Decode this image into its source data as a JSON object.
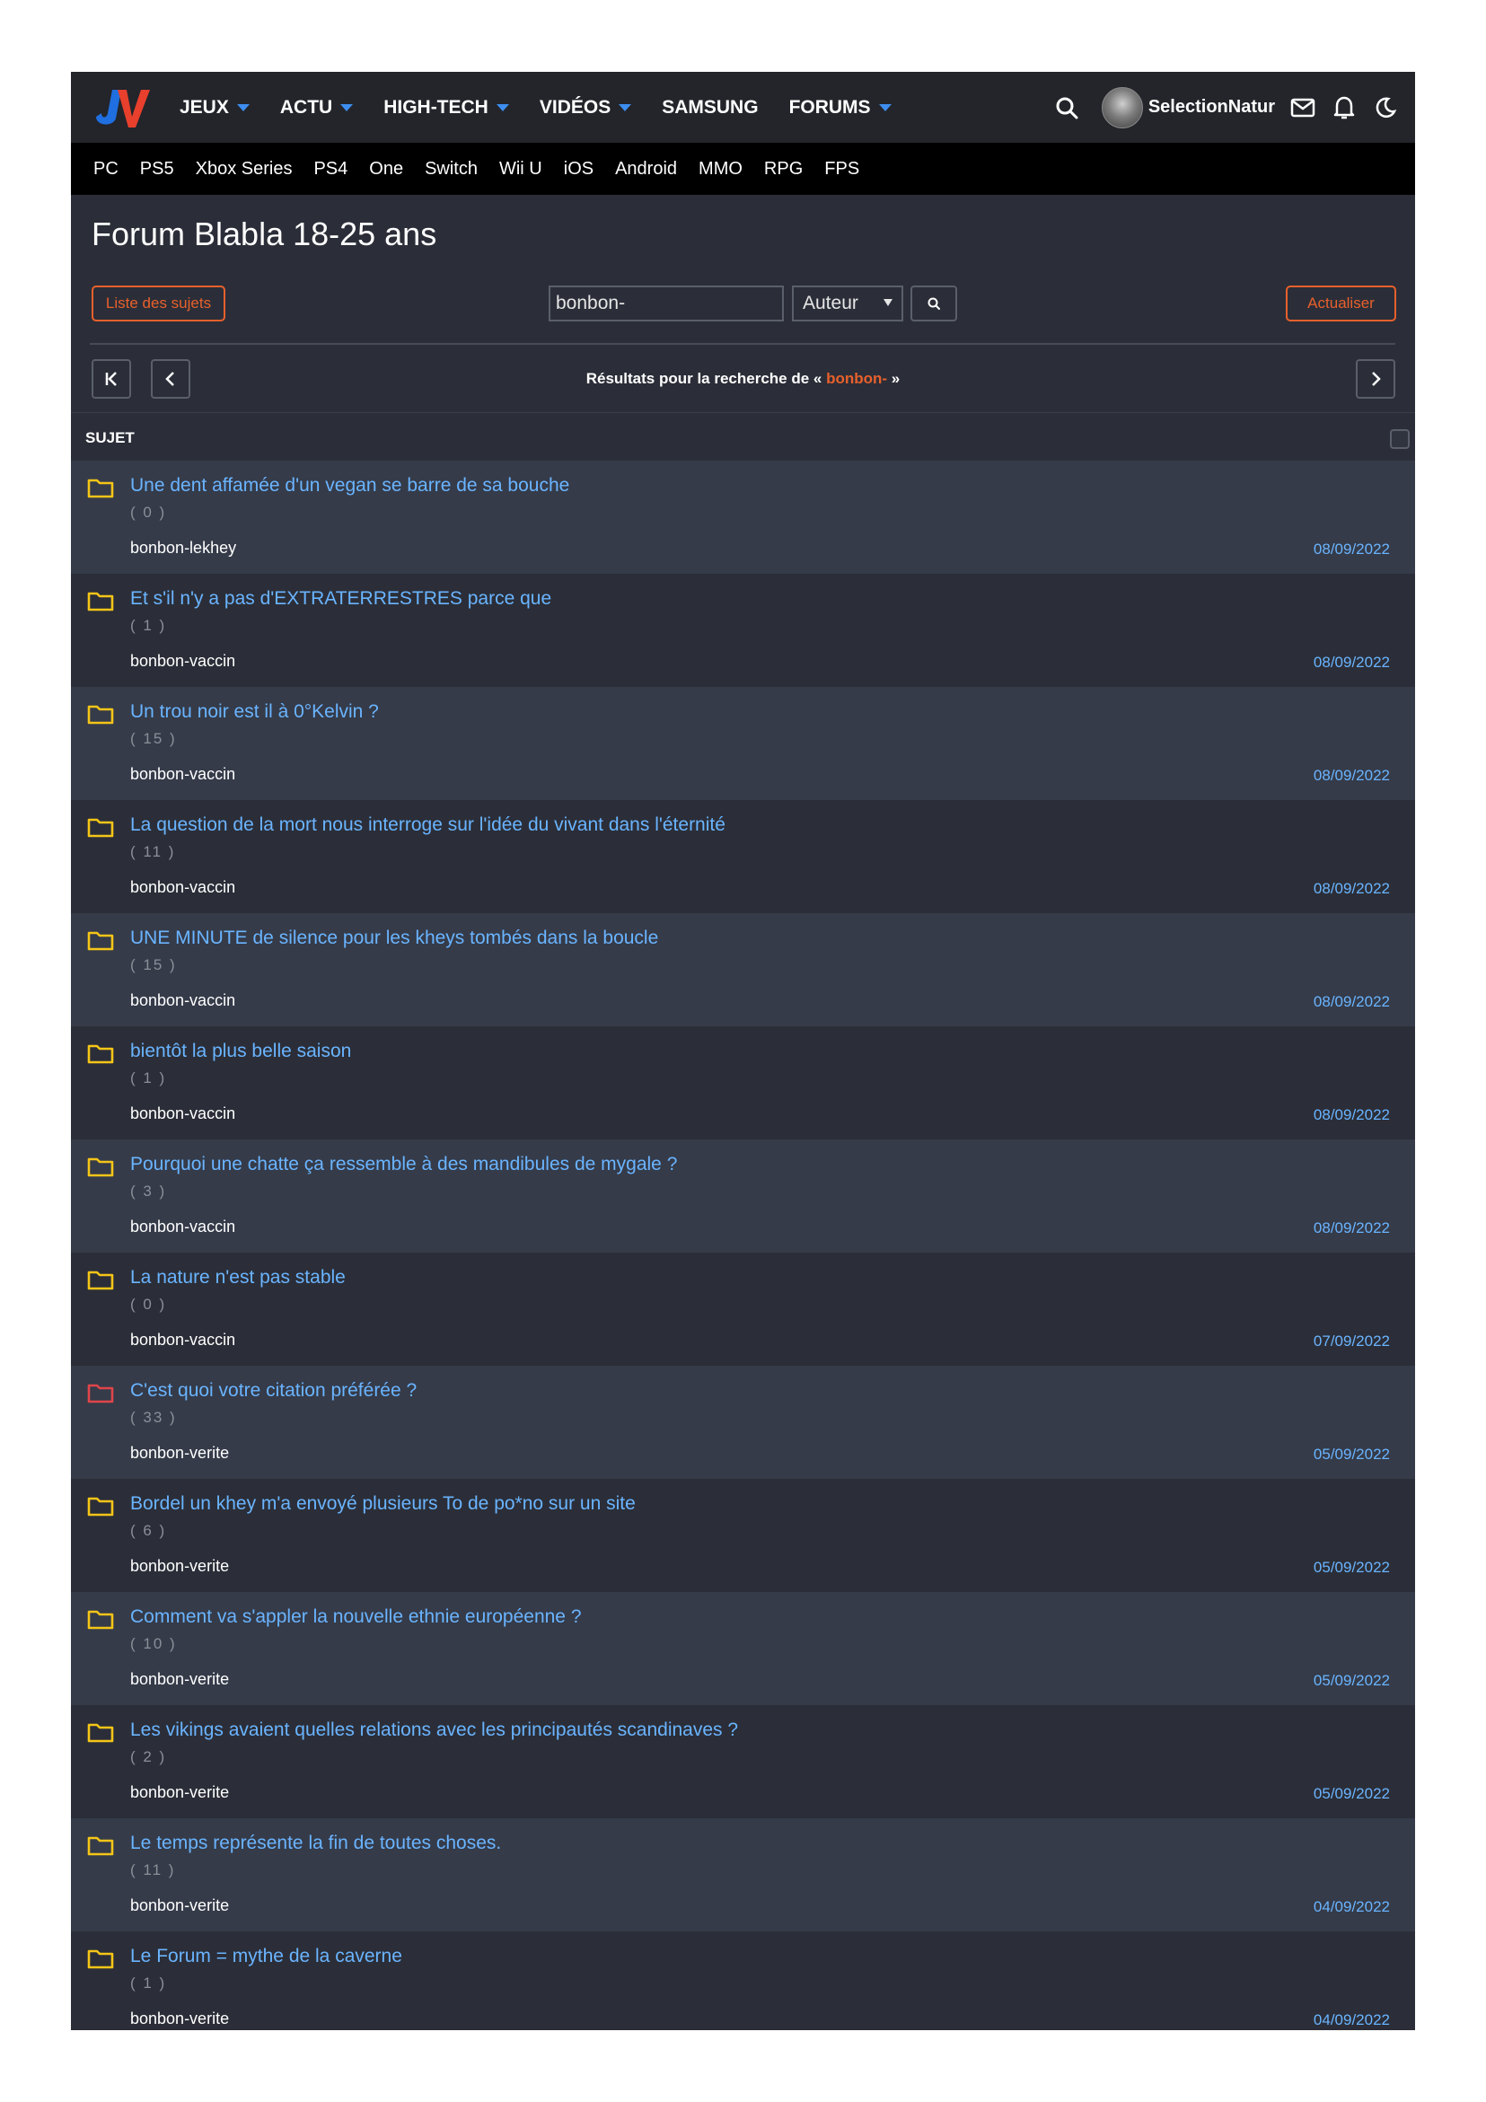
{
  "nav": {
    "items": [
      {
        "label": "JEUX",
        "caret": true
      },
      {
        "label": "ACTU",
        "caret": true
      },
      {
        "label": "HIGH-TECH",
        "caret": true
      },
      {
        "label": "VIDÉOS",
        "caret": true
      },
      {
        "label": "SAMSUNG",
        "caret": false
      },
      {
        "label": "FORUMS",
        "caret": true
      }
    ],
    "username": "SelectionNatur",
    "icons": [
      "search-icon",
      "avatar",
      "mail-icon",
      "bell-icon",
      "moon-icon"
    ]
  },
  "subnav": [
    "PC",
    "PS5",
    "Xbox Series",
    "PS4",
    "One",
    "Switch",
    "Wii U",
    "iOS",
    "Android",
    "MMO",
    "RPG",
    "FPS"
  ],
  "forum": {
    "title": "Forum Blabla 18-25 ans",
    "list_button": "Liste des sujets",
    "search_value": "bonbon-",
    "search_type": "Auteur",
    "refresh_button": "Actualiser",
    "results_prefix": "Résultats pour la recherche de « ",
    "results_query": "bonbon-",
    "results_suffix": " »",
    "column_label": "SUJET"
  },
  "colors": {
    "accent_orange": "#e8602c",
    "link_blue": "#6ab4ff",
    "folder_yellow": "#f5c518",
    "folder_red": "#e0454a"
  },
  "topics": [
    {
      "title": "Une dent affamée d'un vegan se barre de sa bouche",
      "count": "( 0 )",
      "author": "bonbon-lekhey",
      "date": "08/09/2022",
      "folder": "yellow"
    },
    {
      "title": "Et s'il n'y a pas d'EXTRATERRESTRES parce que",
      "count": "( 1 )",
      "author": "bonbon-vaccin",
      "date": "08/09/2022",
      "folder": "yellow"
    },
    {
      "title": "Un trou noir est il à 0°Kelvin ?",
      "count": "( 15 )",
      "author": "bonbon-vaccin",
      "date": "08/09/2022",
      "folder": "yellow"
    },
    {
      "title": "La question de la mort nous interroge sur l'idée du vivant dans l'éternité",
      "count": "( 11 )",
      "author": "bonbon-vaccin",
      "date": "08/09/2022",
      "folder": "yellow"
    },
    {
      "title": "UNE MINUTE de silence pour les kheys tombés dans la boucle",
      "count": "( 15 )",
      "author": "bonbon-vaccin",
      "date": "08/09/2022",
      "folder": "yellow"
    },
    {
      "title": "bientôt la plus belle saison",
      "count": "( 1 )",
      "author": "bonbon-vaccin",
      "date": "08/09/2022",
      "folder": "yellow"
    },
    {
      "title": "Pourquoi une chatte ça ressemble à des mandibules de mygale ?",
      "count": "( 3 )",
      "author": "bonbon-vaccin",
      "date": "08/09/2022",
      "folder": "yellow"
    },
    {
      "title": "La nature n'est pas stable",
      "count": "( 0 )",
      "author": "bonbon-vaccin",
      "date": "07/09/2022",
      "folder": "yellow"
    },
    {
      "title": "C'est quoi votre citation préférée ?",
      "count": "( 33 )",
      "author": "bonbon-verite",
      "date": "05/09/2022",
      "folder": "red"
    },
    {
      "title": "Bordel un khey m'a envoyé plusieurs To de po*no sur un site",
      "count": "( 6 )",
      "author": "bonbon-verite",
      "date": "05/09/2022",
      "folder": "yellow"
    },
    {
      "title": "Comment va s'appler la nouvelle ethnie européenne ?",
      "count": "( 10 )",
      "author": "bonbon-verite",
      "date": "05/09/2022",
      "folder": "yellow"
    },
    {
      "title": "Les vikings avaient quelles relations avec les principautés scandinaves ?",
      "count": "( 2 )",
      "author": "bonbon-verite",
      "date": "05/09/2022",
      "folder": "yellow"
    },
    {
      "title": "Le temps représente la fin de toutes choses.",
      "count": "( 11 )",
      "author": "bonbon-verite",
      "date": "04/09/2022",
      "folder": "yellow"
    },
    {
      "title": "Le Forum = mythe de la caverne",
      "count": "( 1 )",
      "author": "bonbon-verite",
      "date": "04/09/2022",
      "folder": "yellow"
    }
  ]
}
